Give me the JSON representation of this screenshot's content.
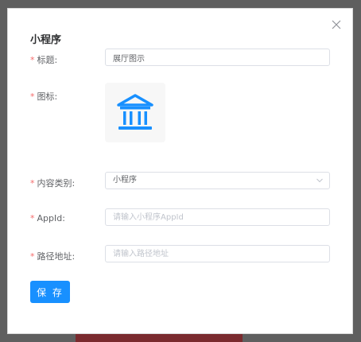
{
  "dialog": {
    "title": "小程序",
    "close_icon": "close-icon"
  },
  "form": {
    "title": {
      "label": "标题:",
      "value": "展厅图示"
    },
    "icon": {
      "label": "图标:",
      "icon": "museum-building-icon",
      "icon_color": "#1890ff"
    },
    "content_type": {
      "label": "内容类别:",
      "value": "小程序"
    },
    "appid": {
      "label": "AppId:",
      "placeholder": "请输入小程序AppId"
    },
    "path": {
      "label": "路径地址:",
      "placeholder": "请输入路径地址"
    },
    "required_mark": "*"
  },
  "actions": {
    "save_label": "保 存"
  },
  "colors": {
    "primary": "#1890ff",
    "required": "#f56c6c"
  }
}
